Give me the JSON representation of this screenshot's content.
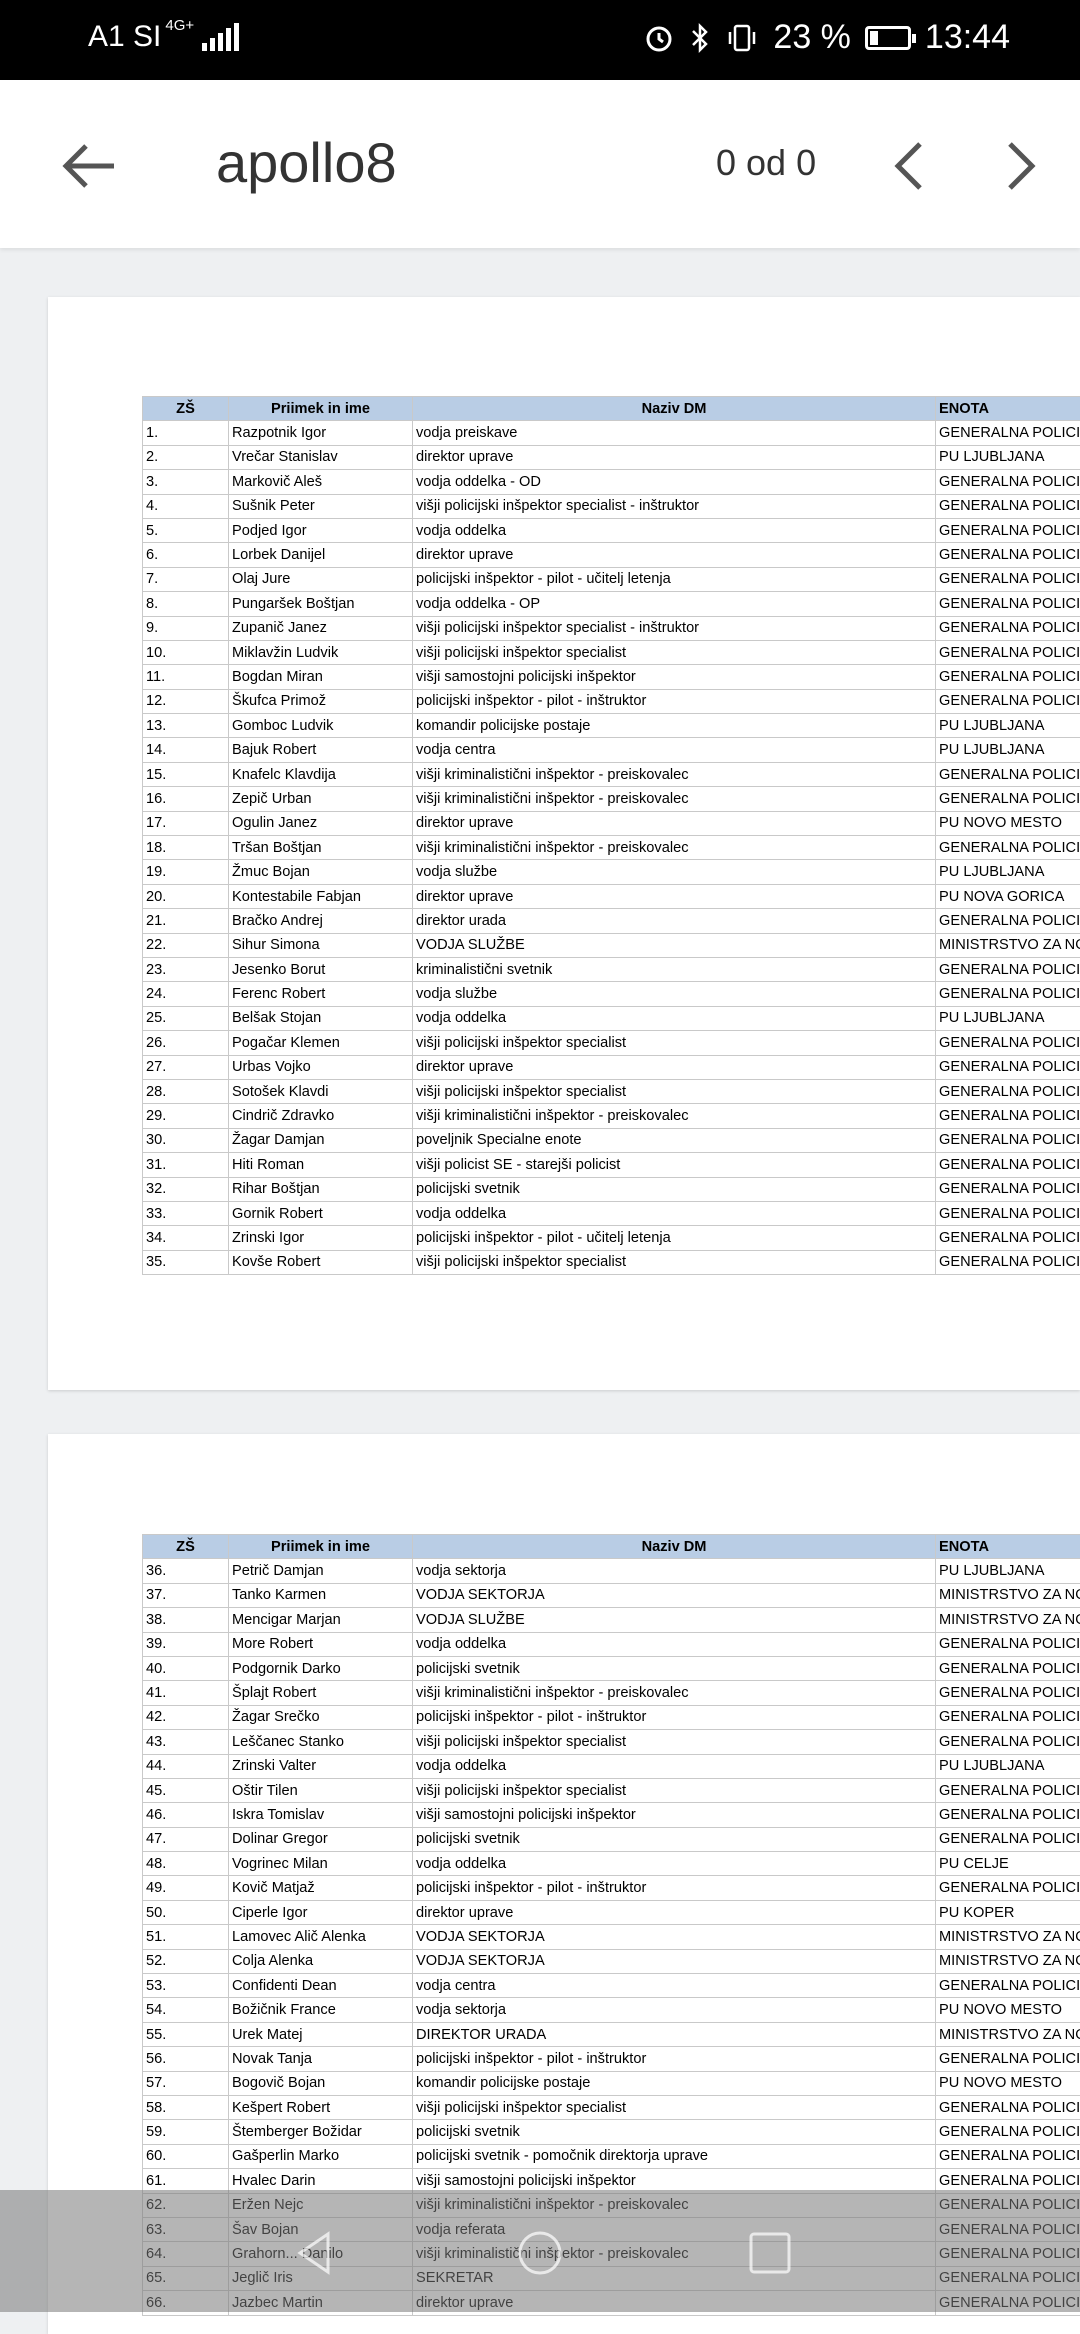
{
  "status_bar": {
    "carrier": "A1 SI",
    "network": "4G+",
    "battery": "23 %",
    "time": "13:44"
  },
  "toolbar": {
    "title": "apollo8",
    "match_count": "0 od 0",
    "icons": [
      "back-arrow-icon",
      "chevron-left-icon",
      "chevron-right-icon"
    ]
  },
  "table_headers": [
    "ZŠ",
    "Priimek in ime",
    "Naziv DM",
    "ENOTA"
  ],
  "page1_rows": [
    [
      "1.",
      "Razpotnik Igor",
      "vodja preiskave",
      "GENERALNA POLICIJ"
    ],
    [
      "2.",
      "Vrečar Stanislav",
      "direktor uprave",
      "PU LJUBLJANA"
    ],
    [
      "3.",
      "Markovič Aleš",
      "vodja oddelka - OD",
      "GENERALNA POLICIJ"
    ],
    [
      "4.",
      "Sušnik Peter",
      "višji policijski inšpektor specialist - inštruktor",
      "GENERALNA POLICIJ"
    ],
    [
      "5.",
      "Podjed Igor",
      "vodja oddelka",
      "GENERALNA POLICIJ"
    ],
    [
      "6.",
      "Lorbek Danijel",
      "direktor uprave",
      "GENERALNA POLICIJ"
    ],
    [
      "7.",
      "Olaj Jure",
      "policijski inšpektor - pilot - učitelj letenja",
      "GENERALNA POLICIJ"
    ],
    [
      "8.",
      "Pungaršek Boštjan",
      "vodja oddelka - OP",
      "GENERALNA POLICIJ"
    ],
    [
      "9.",
      "Zupanič Janez",
      "višji policijski inšpektor specialist - inštruktor",
      "GENERALNA POLICIJ"
    ],
    [
      "10.",
      "Miklavžin Ludvik",
      "višji policijski inšpektor specialist",
      "GENERALNA POLICIJ"
    ],
    [
      "11.",
      "Bogdan Miran",
      "višji samostojni policijski inšpektor",
      "GENERALNA POLICIJ"
    ],
    [
      "12.",
      "Škufca Primož",
      "policijski inšpektor - pilot - inštruktor",
      "GENERALNA POLICIJ"
    ],
    [
      "13.",
      "Gomboc Ludvik",
      "komandir policijske postaje",
      "PU LJUBLJANA"
    ],
    [
      "14.",
      "Bajuk Robert",
      "vodja centra",
      "PU LJUBLJANA"
    ],
    [
      "15.",
      "Knafelc Klavdija",
      "višji kriminalistični inšpektor - preiskovalec",
      "GENERALNA POLICIJ"
    ],
    [
      "16.",
      "Zepič Urban",
      "višji kriminalistični inšpektor - preiskovalec",
      "GENERALNA POLICIJ"
    ],
    [
      "17.",
      "Ogulin Janez",
      "direktor uprave",
      "PU NOVO MESTO"
    ],
    [
      "18.",
      "Tršan Boštjan",
      "višji kriminalistični inšpektor - preiskovalec",
      "GENERALNA POLICIJ"
    ],
    [
      "19.",
      "Žmuc Bojan",
      "vodja službe",
      "PU LJUBLJANA"
    ],
    [
      "20.",
      "Kontestabile Fabjan",
      "direktor uprave",
      "PU NOVA GORICA"
    ],
    [
      "21.",
      "Bračko Andrej",
      "direktor urada",
      "GENERALNA POLICIJ"
    ],
    [
      "22.",
      "Sihur Simona",
      "VODJA SLUŽBE",
      "MINISTRSTVO ZA NO"
    ],
    [
      "23.",
      "Jesenko Borut",
      "kriminalistični svetnik",
      "GENERALNA POLICIJ"
    ],
    [
      "24.",
      "Ferenc Robert",
      "vodja službe",
      "GENERALNA POLICIJ"
    ],
    [
      "25.",
      "Belšak Stojan",
      "vodja oddelka",
      "PU LJUBLJANA"
    ],
    [
      "26.",
      "Pogačar Klemen",
      "višji policijski inšpektor specialist",
      "GENERALNA POLICIJ"
    ],
    [
      "27.",
      "Urbas Vojko",
      "direktor uprave",
      "GENERALNA POLICIJ"
    ],
    [
      "28.",
      "Sotošek Klavdi",
      "višji policijski inšpektor specialist",
      "GENERALNA POLICIJ"
    ],
    [
      "29.",
      "Cindrič Zdravko",
      "višji kriminalistični inšpektor - preiskovalec",
      "GENERALNA POLICIJ"
    ],
    [
      "30.",
      "Žagar Damjan",
      "poveljnik Specialne enote",
      "GENERALNA POLICIJ"
    ],
    [
      "31.",
      "Hiti Roman",
      "višji policist SE - starejši policist",
      "GENERALNA POLICIJ"
    ],
    [
      "32.",
      "Rihar Boštjan",
      "policijski svetnik",
      "GENERALNA POLICIJ"
    ],
    [
      "33.",
      "Gornik Robert",
      "vodja oddelka",
      "GENERALNA POLICIJ"
    ],
    [
      "34.",
      "Zrinski Igor",
      "policijski inšpektor - pilot - učitelj letenja",
      "GENERALNA POLICIJ"
    ],
    [
      "35.",
      "Kovše Robert",
      "višji policijski inšpektor specialist",
      "GENERALNA POLICIJ"
    ]
  ],
  "page2_rows": [
    [
      "36.",
      "Petrič Damjan",
      "vodja sektorja",
      "PU LJUBLJANA"
    ],
    [
      "37.",
      "Tanko Karmen",
      "VODJA SEKTORJA",
      "MINISTRSTVO ZA NO"
    ],
    [
      "38.",
      "Mencigar Marjan",
      "VODJA SLUŽBE",
      "MINISTRSTVO ZA NO"
    ],
    [
      "39.",
      "More Robert",
      "vodja oddelka",
      "GENERALNA POLICIJ"
    ],
    [
      "40.",
      "Podgornik Darko",
      "policijski svetnik",
      "GENERALNA POLICIJ"
    ],
    [
      "41.",
      "Šplajt Robert",
      "višji kriminalistični inšpektor - preiskovalec",
      "GENERALNA POLICIJ"
    ],
    [
      "42.",
      "Žagar Srečko",
      "policijski inšpektor - pilot - inštruktor",
      "GENERALNA POLICIJ"
    ],
    [
      "43.",
      "Leščanec Stanko",
      "višji policijski inšpektor specialist",
      "GENERALNA POLICIJ"
    ],
    [
      "44.",
      "Zrinski Valter",
      "vodja oddelka",
      "PU LJUBLJANA"
    ],
    [
      "45.",
      "Oštir Tilen",
      "višji policijski inšpektor specialist",
      "GENERALNA POLICIJ"
    ],
    [
      "46.",
      "Iskra Tomislav",
      "višji samostojni policijski inšpektor",
      "GENERALNA POLICIJ"
    ],
    [
      "47.",
      "Dolinar Gregor",
      "policijski svetnik",
      "GENERALNA POLICIJ"
    ],
    [
      "48.",
      "Vogrinec Milan",
      "vodja oddelka",
      "PU CELJE"
    ],
    [
      "49.",
      "Kovič Matjaž",
      "policijski inšpektor - pilot - inštruktor",
      "GENERALNA POLICIJ"
    ],
    [
      "50.",
      "Ciperle Igor",
      "direktor uprave",
      "PU KOPER"
    ],
    [
      "51.",
      "Lamovec Alič Alenka",
      "VODJA SEKTORJA",
      "MINISTRSTVO ZA NO"
    ],
    [
      "52.",
      "Colja Alenka",
      "VODJA SEKTORJA",
      "MINISTRSTVO ZA NO"
    ],
    [
      "53.",
      "Confidenti Dean",
      "vodja centra",
      "GENERALNA POLICIJ"
    ],
    [
      "54.",
      "Božičnik France",
      "vodja sektorja",
      "PU NOVO MESTO"
    ],
    [
      "55.",
      "Urek Matej",
      "DIREKTOR URADA",
      "MINISTRSTVO ZA NO"
    ],
    [
      "56.",
      "Novak Tanja",
      "policijski inšpektor - pilot - inštruktor",
      "GENERALNA POLICIJ"
    ],
    [
      "57.",
      "Bogovič Bojan",
      "komandir policijske postaje",
      "PU NOVO MESTO"
    ],
    [
      "58.",
      "Kešpert Robert",
      "višji policijski inšpektor specialist",
      "GENERALNA POLICIJ"
    ],
    [
      "59.",
      "Štemberger Božidar",
      "policijski svetnik",
      "GENERALNA POLICIJ"
    ],
    [
      "60.",
      "Gašperlin Marko",
      "policijski svetnik - pomočnik direktorja uprave",
      "GENERALNA POLICIJ"
    ],
    [
      "61.",
      "Hvalec Darin",
      "višji samostojni policijski inšpektor",
      "GENERALNA POLICIJ"
    ],
    [
      "62.",
      "Eržen Nejc",
      "višji kriminalistični inšpektor - preiskovalec",
      "GENERALNA POLICIJ"
    ],
    [
      "63.",
      "Šav Bojan",
      "vodja referata",
      "GENERALNA POLICIJ"
    ],
    [
      "64.",
      "Grahorn... Danilo",
      "višji kriminalistični inšpektor - preiskovalec",
      "GENERALNA POLICIJ"
    ],
    [
      "65.",
      "Jeglič Iris",
      "SEKRETAR",
      "GENERALNA POLICIJ"
    ],
    [
      "66.",
      "Jazbec Martin",
      "direktor uprave",
      "GENERALNA POLICIJ"
    ]
  ],
  "nav_bar": {
    "icons": [
      "back-triangle-icon",
      "home-circle-icon",
      "recents-square-icon"
    ]
  }
}
